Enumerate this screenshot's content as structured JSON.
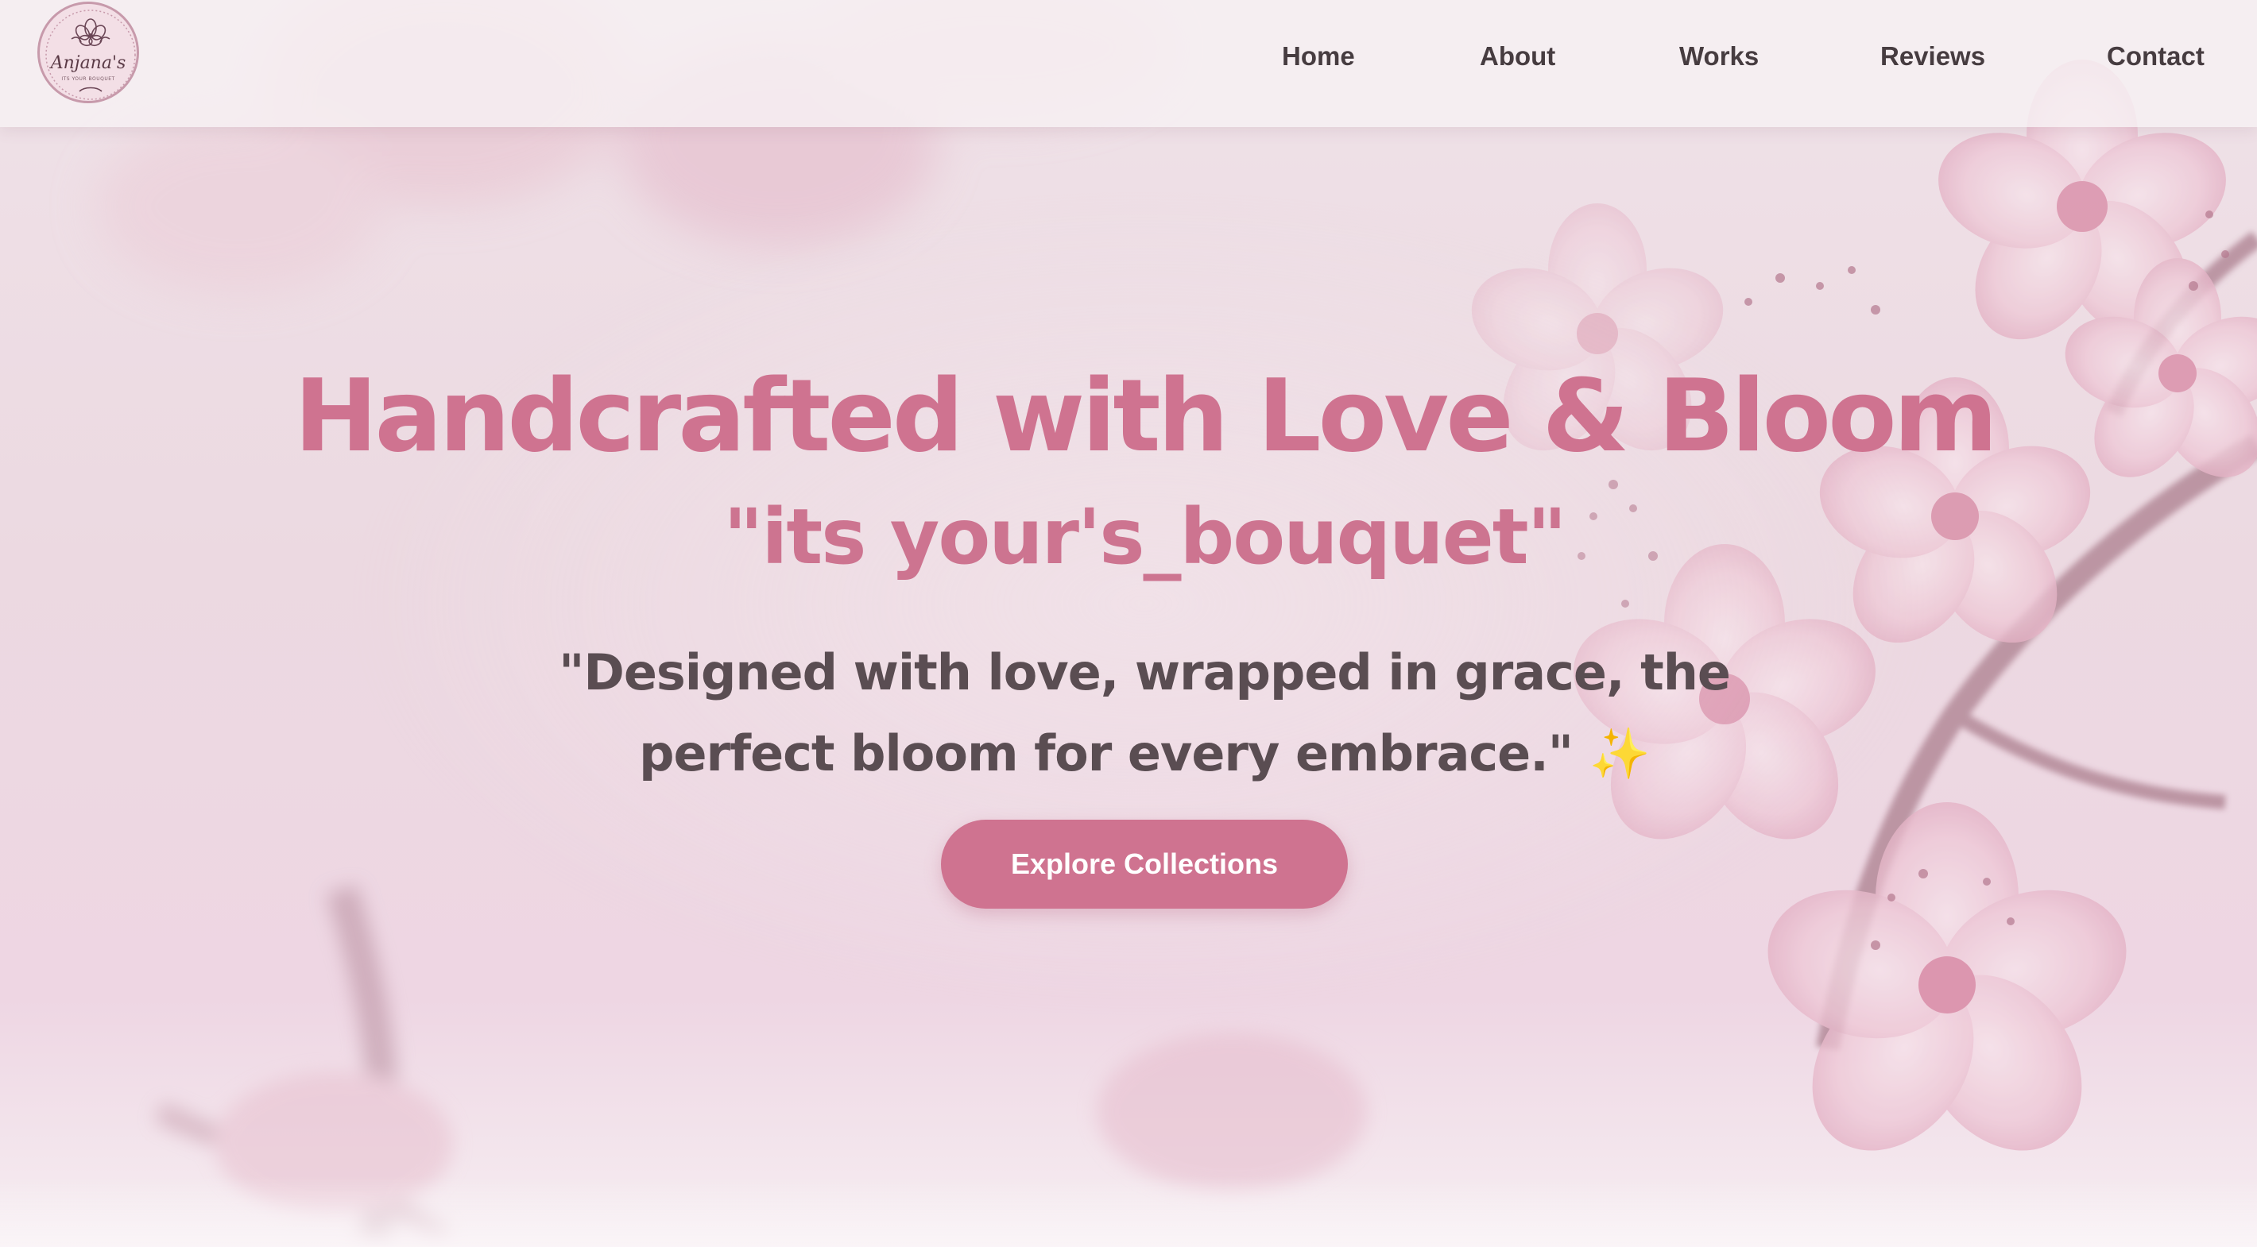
{
  "brand": {
    "logo_name": "Anjana's",
    "logo_tagline": "ITS YOUR BOUQUET"
  },
  "nav": {
    "items": [
      {
        "label": "Home"
      },
      {
        "label": "About"
      },
      {
        "label": "Works"
      },
      {
        "label": "Reviews"
      },
      {
        "label": "Contact"
      }
    ]
  },
  "hero": {
    "title": "Handcrafted with Love & Bloom",
    "subtitle": "\"its your's_bouquet\"",
    "quote_line1": "\"Designed with love, wrapped in grace, the",
    "quote_line2": "perfect bloom for every embrace.\"",
    "quote_emoji": "✨",
    "cta_label": "Explore Collections"
  },
  "colors": {
    "accent": "#cf7390",
    "nav_text": "#463c40",
    "quote_text": "#5a4d52",
    "background": "#efe2e8"
  },
  "icons": {
    "logo": "flower-bouquet-icon",
    "sparkle": "sparkles-icon"
  }
}
